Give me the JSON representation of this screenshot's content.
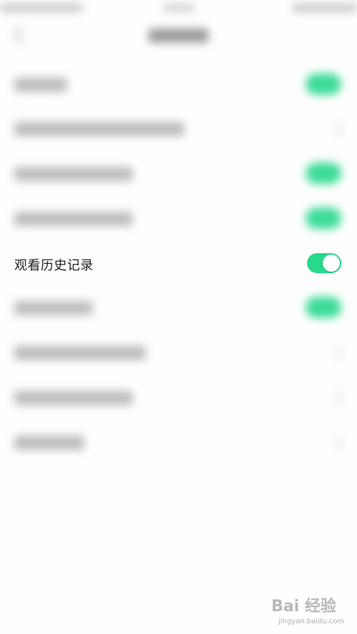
{
  "settings_item": {
    "label": "观看历史记录",
    "toggle_on": true,
    "toggle_color": "#27d98a"
  },
  "watermark": {
    "brand": "Bai 经验",
    "url": "jingyan.baidu.com",
    "icon": "paw-icon"
  },
  "colors": {
    "accent": "#27d98a",
    "background": "#fefefe"
  }
}
